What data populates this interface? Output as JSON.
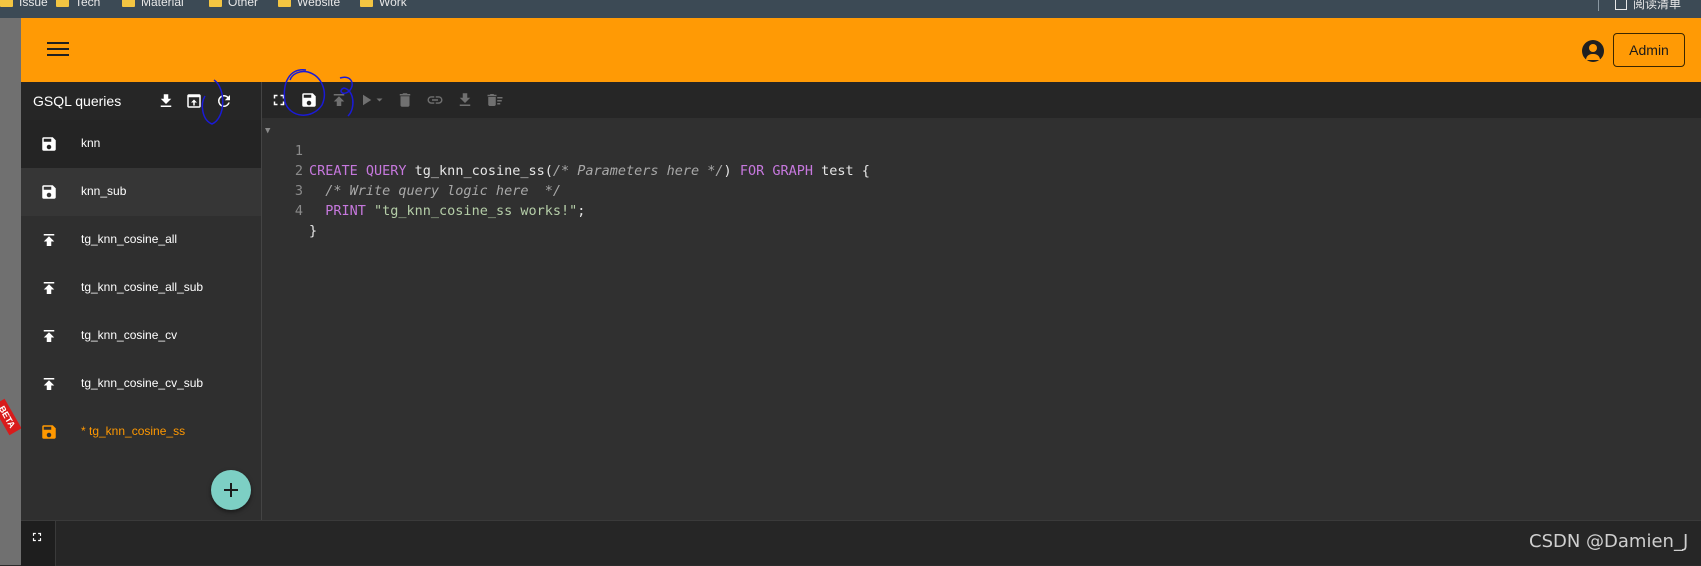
{
  "bookmarks": [
    {
      "label": "Issue"
    },
    {
      "label": "Tech"
    },
    {
      "label": "Material"
    },
    {
      "label": "Other"
    },
    {
      "label": "Website"
    },
    {
      "label": "Work"
    }
  ],
  "bookmarks_right_label": "阅读清单",
  "appbar": {
    "account_button": "Admin",
    "accent_color": "#ff9a05"
  },
  "beta_ribbon": "BETA",
  "sidebar": {
    "title": "GSQL queries",
    "queries": [
      {
        "label": "knn",
        "icon": "save-icon"
      },
      {
        "label": "knn_sub",
        "icon": "save-icon"
      },
      {
        "label": "tg_knn_cosine_all",
        "icon": "publish-icon"
      },
      {
        "label": "tg_knn_cosine_all_sub",
        "icon": "publish-icon"
      },
      {
        "label": "tg_knn_cosine_cv",
        "icon": "publish-icon"
      },
      {
        "label": "tg_knn_cosine_cv_sub",
        "icon": "publish-icon"
      },
      {
        "label": "* tg_knn_cosine_ss",
        "icon": "save-icon"
      }
    ]
  },
  "editor": {
    "line_numbers": [
      "1",
      "2",
      "3",
      "4"
    ],
    "line1": {
      "k1": "CREATE QUERY",
      "t1": " tg_knn_cosine_ss(",
      "c1": "/* Parameters here */",
      "t2": ") ",
      "k2": "FOR GRAPH",
      "t3": " test {"
    },
    "line2": {
      "c1": "  /* Write query logic here  */"
    },
    "line3": {
      "k1": "  PRINT ",
      "s1": "\"tg_knn_cosine_ss works!\"",
      "t1": ";"
    },
    "line4": {
      "t1": "}"
    }
  },
  "watermark": "CSDN @Damien_J"
}
